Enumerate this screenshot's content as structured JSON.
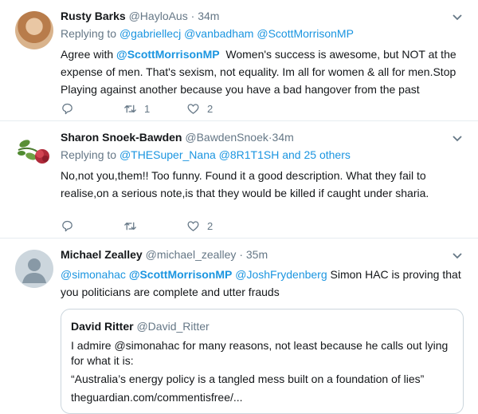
{
  "tweets": [
    {
      "name": "Rusty Barks",
      "handle": "@HayloAus",
      "sep": "·",
      "time": "34m",
      "reply_prefix": "Replying to",
      "reply_to": [
        "@gabriellecj",
        "@vanbadham",
        "@ScottMorrisonMP"
      ],
      "text_prefix": "Agree with",
      "text_mention": "@ScottMorrisonMP",
      "text_rest": "Women's success is awesome, but NOT at the expense of men. That's sexism, not equality. Im all for women & all for men.Stop Playing against another because you have a bad hangover from the past",
      "replies": "",
      "retweets": "1",
      "likes": "2"
    },
    {
      "name": "Sharon Snoek-Bawden",
      "handle": "@BawdenSnoek",
      "sep": "·",
      "time": "34m",
      "reply_prefix": "Replying to",
      "reply_to": [
        "@THESuper_Nana",
        "@8R1T1SH"
      ],
      "reply_more": "and 25 others",
      "text": "No,not you,them!! Too funny. Found it a good description. What they fail to realise,on a serious note,is that they would be killed if caught under sharia.",
      "replies": "",
      "retweets": "",
      "likes": "2"
    },
    {
      "name": "Michael Zealley",
      "handle": "@michael_zealley",
      "sep": "·",
      "time": "35m",
      "mentions": [
        "@simonahac",
        "@ScottMorrisonMP",
        "@JoshFrydenberg"
      ],
      "text_rest": "Simon HAC is proving that you politicians are complete and utter frauds",
      "quote": {
        "name": "David Ritter",
        "handle": "@David_Ritter",
        "line1": "I admire @simonahac for many reasons, not least because he calls out lying for what it is:",
        "line2": "“Australia’s energy policy is a tangled mess built on a foundation of lies”",
        "line3": "theguardian.com/commentisfree/..."
      }
    }
  ],
  "icons": {
    "reply": "reply-icon",
    "retweet": "retweet-icon",
    "like": "heart-icon",
    "caret": "chevron-down-icon"
  },
  "colors": {
    "link": "#1b95e0",
    "muted": "#657786",
    "border": "#e6ecf0"
  }
}
